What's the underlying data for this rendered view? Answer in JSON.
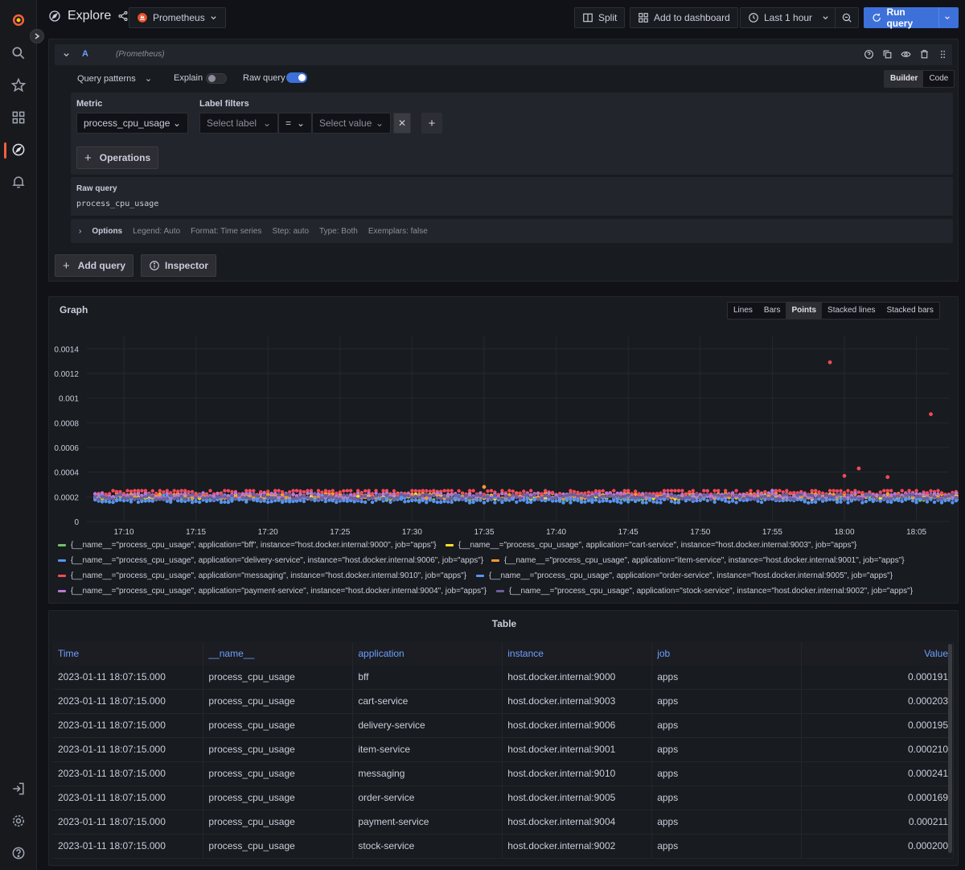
{
  "topbar": {
    "title": "Explore",
    "datasource": "Prometheus",
    "split_label": "Split",
    "add_dashboard_label": "Add to dashboard",
    "time_range_label": "Last 1 hour",
    "run_query_label": "Run query"
  },
  "query": {
    "ref_id": "A",
    "datasource_hint": "(Prometheus)",
    "query_patterns_label": "Query patterns",
    "explain_label": "Explain",
    "raw_query_toggle_label": "Raw query",
    "mode_options": [
      "Builder",
      "Code"
    ],
    "mode_selected": "Builder",
    "metric_label": "Metric",
    "metric_value": "process_cpu_usage",
    "label_filters_label": "Label filters",
    "select_label_placeholder": "Select label",
    "operator_value": "=",
    "select_value_placeholder": "Select value",
    "operations_label": "Operations",
    "raw_query_heading": "Raw query",
    "raw_query_text": "process_cpu_usage",
    "options_label": "Options",
    "options_summary": [
      "Legend: Auto",
      "Format: Time series",
      "Step: auto",
      "Type: Both",
      "Exemplars: false"
    ],
    "add_query_label": "Add query",
    "inspector_label": "Inspector"
  },
  "graph": {
    "title": "Graph",
    "view_options": [
      "Lines",
      "Bars",
      "Points",
      "Stacked lines",
      "Stacked bars"
    ],
    "view_selected": "Points"
  },
  "chart_data": {
    "type": "scatter",
    "x_ticks": [
      "17:10",
      "17:15",
      "17:20",
      "17:25",
      "17:30",
      "17:35",
      "17:40",
      "17:45",
      "17:50",
      "17:55",
      "18:00",
      "18:05"
    ],
    "y_ticks": [
      "0",
      "0.0002",
      "0.0004",
      "0.0006",
      "0.0008",
      "0.001",
      "0.0012",
      "0.0014"
    ],
    "ylim": [
      0,
      0.0015
    ],
    "grid": true,
    "legend_placement": "bottom",
    "series": [
      {
        "name": "{__name__=\"process_cpu_usage\", application=\"bff\", instance=\"host.docker.internal:9000\", job=\"apps\"}",
        "color": "#73bf69",
        "last_value": 0.000191
      },
      {
        "name": "{__name__=\"process_cpu_usage\", application=\"cart-service\", instance=\"host.docker.internal:9003\", job=\"apps\"}",
        "color": "#fade2a",
        "last_value": 0.000203
      },
      {
        "name": "{__name__=\"process_cpu_usage\", application=\"delivery-service\", instance=\"host.docker.internal:9006\", job=\"apps\"}",
        "color": "#5794f2",
        "last_value": 0.000195
      },
      {
        "name": "{__name__=\"process_cpu_usage\", application=\"item-service\", instance=\"host.docker.internal:9001\", job=\"apps\"}",
        "color": "#ff9830",
        "last_value": 0.00021
      },
      {
        "name": "{__name__=\"process_cpu_usage\", application=\"messaging\", instance=\"host.docker.internal:9010\", job=\"apps\"}",
        "color": "#f2495c",
        "last_value": 0.000241
      },
      {
        "name": "{__name__=\"process_cpu_usage\", application=\"order-service\", instance=\"host.docker.internal:9005\", job=\"apps\"}",
        "color": "#5794f2",
        "last_value": 0.000169
      },
      {
        "name": "{__name__=\"process_cpu_usage\", application=\"payment-service\", instance=\"host.docker.internal:9004\", job=\"apps\"}",
        "color": "#b877d9",
        "last_value": 0.000211
      },
      {
        "name": "{__name__=\"process_cpu_usage\", application=\"stock-service\", instance=\"host.docker.internal:9002\", job=\"apps\"}",
        "color": "#705da0",
        "last_value": 0.0002
      }
    ],
    "outliers": [
      {
        "series": "messaging",
        "x": "17:59",
        "y": 0.00129
      },
      {
        "series": "messaging",
        "x": "18:06",
        "y": 0.00087
      },
      {
        "series": "messaging",
        "x": "18:01",
        "y": 0.00043
      },
      {
        "series": "messaging",
        "x": "18:03",
        "y": 0.00036
      },
      {
        "series": "messaging",
        "x": "18:00",
        "y": 0.00037
      },
      {
        "series": "item-service",
        "x": "17:35",
        "y": 0.00028
      },
      {
        "series": "payment-service",
        "x": "17:55",
        "y": 0.00025
      }
    ]
  },
  "table": {
    "title": "Table",
    "columns": [
      "Time",
      "__name__",
      "application",
      "instance",
      "job",
      "Value"
    ],
    "rows": [
      [
        "2023-01-11 18:07:15.000",
        "process_cpu_usage",
        "bff",
        "host.docker.internal:9000",
        "apps",
        "0.000191"
      ],
      [
        "2023-01-11 18:07:15.000",
        "process_cpu_usage",
        "cart-service",
        "host.docker.internal:9003",
        "apps",
        "0.000203"
      ],
      [
        "2023-01-11 18:07:15.000",
        "process_cpu_usage",
        "delivery-service",
        "host.docker.internal:9006",
        "apps",
        "0.000195"
      ],
      [
        "2023-01-11 18:07:15.000",
        "process_cpu_usage",
        "item-service",
        "host.docker.internal:9001",
        "apps",
        "0.000210"
      ],
      [
        "2023-01-11 18:07:15.000",
        "process_cpu_usage",
        "messaging",
        "host.docker.internal:9010",
        "apps",
        "0.000241"
      ],
      [
        "2023-01-11 18:07:15.000",
        "process_cpu_usage",
        "order-service",
        "host.docker.internal:9005",
        "apps",
        "0.000169"
      ],
      [
        "2023-01-11 18:07:15.000",
        "process_cpu_usage",
        "payment-service",
        "host.docker.internal:9004",
        "apps",
        "0.000211"
      ],
      [
        "2023-01-11 18:07:15.000",
        "process_cpu_usage",
        "stock-service",
        "host.docker.internal:9002",
        "apps",
        "0.000200"
      ]
    ]
  },
  "colors": {
    "accent": "#3d71d9",
    "brand": "#f55f3e",
    "link": "#6e9fff"
  },
  "icons": [
    "grafana-logo-icon",
    "search-icon",
    "star-icon",
    "dashboards-icon",
    "explore-icon",
    "alert-bell-icon",
    "sign-in-icon",
    "gear-icon",
    "help-icon"
  ]
}
